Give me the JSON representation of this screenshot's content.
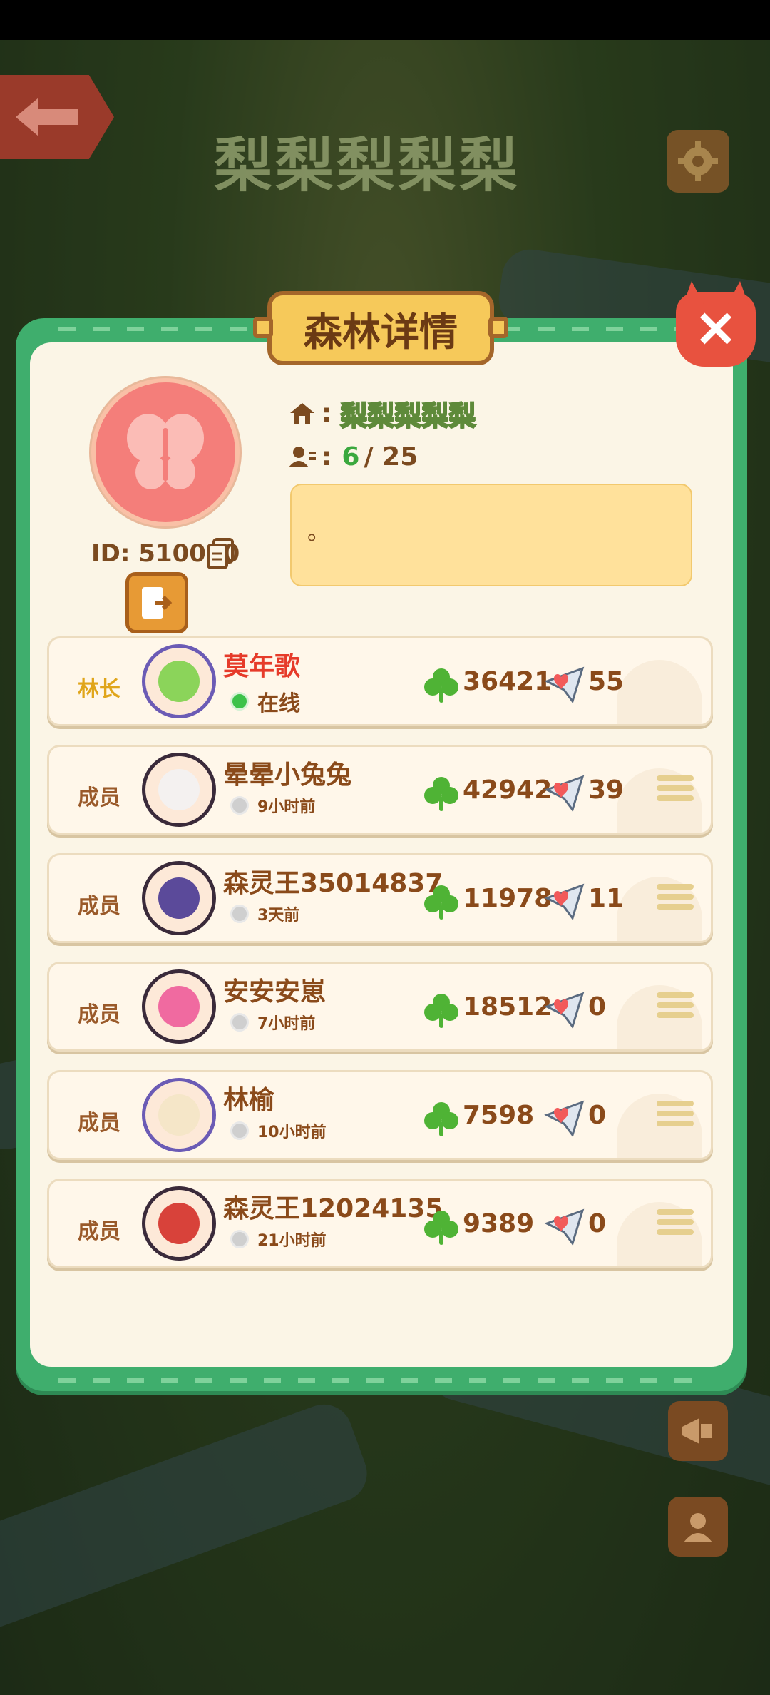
{
  "world": {
    "title": "梨梨梨梨梨"
  },
  "panel": {
    "title": "森林详情",
    "forest_name": "梨梨梨梨梨",
    "id_label": "ID: 510050",
    "member_count_current": "6",
    "member_count_total": "/ 25",
    "notice": "。",
    "colors": {
      "panel_green": "#3fae6d",
      "panel_cream": "#fbf5e6",
      "notice_yellow": "#ffe19b",
      "close_red": "#e8523f"
    }
  },
  "members": [
    {
      "role": "林长",
      "name": "莫年歌",
      "status": "在线",
      "online": true,
      "score": "36421",
      "likes": "55",
      "menu": false
    },
    {
      "role": "成员",
      "name": "晕晕小兔兔",
      "status": "9小时前",
      "online": false,
      "score": "42942",
      "likes": "39",
      "menu": true
    },
    {
      "role": "成员",
      "name": "森灵王35014837",
      "status": "3天前",
      "online": false,
      "score": "11978",
      "likes": "11",
      "menu": true
    },
    {
      "role": "成员",
      "name": "安安安崽",
      "status": "7小时前",
      "online": false,
      "score": "18512",
      "likes": "0",
      "menu": true
    },
    {
      "role": "成员",
      "name": "林榆",
      "status": "10小时前",
      "online": false,
      "score": "7598",
      "likes": "0",
      "menu": true
    },
    {
      "role": "成员",
      "name": "森灵王12024135",
      "status": "21小时前",
      "online": false,
      "score": "9389",
      "likes": "0",
      "menu": true
    }
  ],
  "icons": {
    "back": "arrow-left-icon",
    "settings": "gear-icon",
    "close": "close-icon",
    "home": "home-icon",
    "members": "members-icon",
    "copy": "copy-icon",
    "exit": "exit-icon",
    "clover": "clover-icon",
    "mail": "heart-mail-icon",
    "menu": "menu-icon"
  }
}
